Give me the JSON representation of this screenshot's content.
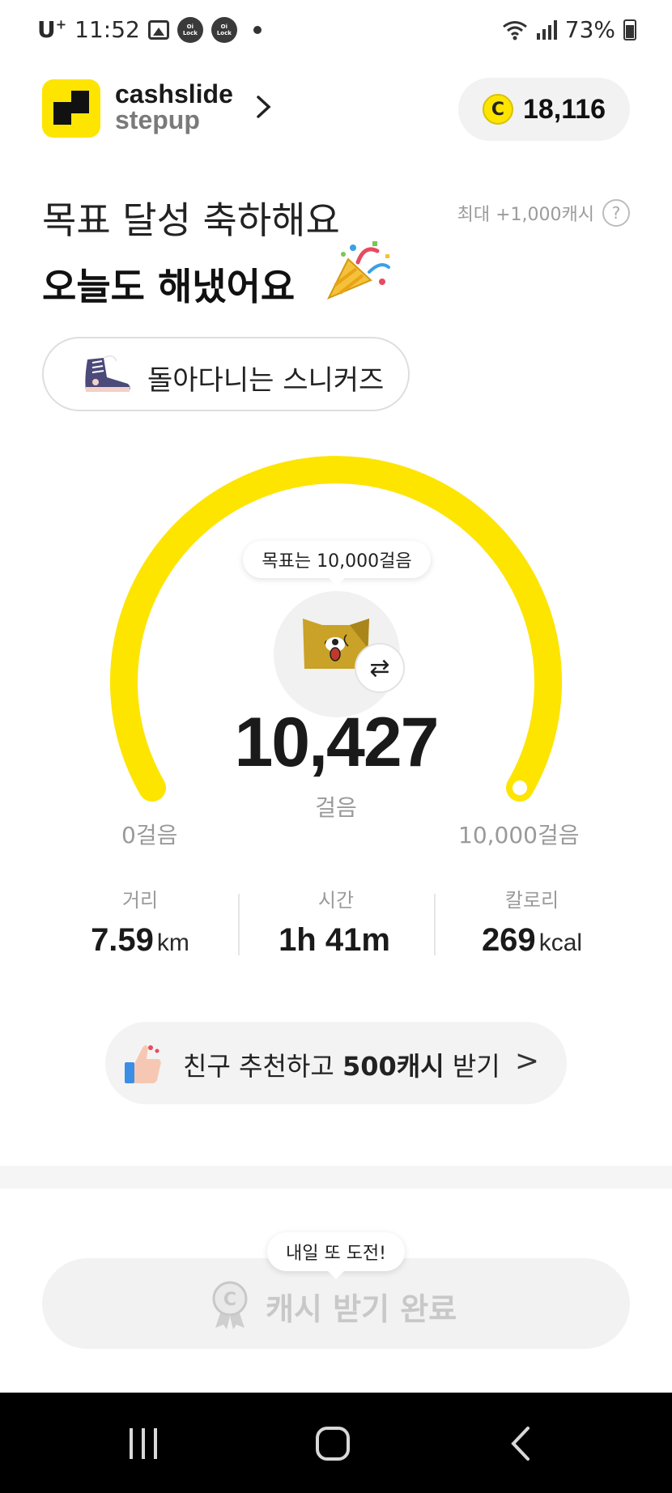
{
  "status_bar": {
    "carrier": "U",
    "carrier_sup": "+",
    "time": "11:52",
    "lock_badge": "Oi\nLock",
    "battery": "73%"
  },
  "header": {
    "brand_line1": "cashslide",
    "brand_line2": "stepup",
    "cash_coin_symbol": "C",
    "cash_amount": "18,116"
  },
  "hero": {
    "title_line1": "목표 달성 축하해요",
    "title_line2": "오늘도 해냈어요",
    "max_reward": "최대 +1,000캐시",
    "help_symbol": "?"
  },
  "badge": {
    "label": "돌아다니는 스니커즈"
  },
  "gauge": {
    "goal_bubble": "목표는 10,000걸음",
    "steps": "10,427",
    "steps_value": 10427,
    "goal_value": 10000,
    "progress_fraction": 1.0,
    "unit": "걸음",
    "min_label": "0걸음",
    "max_label": "10,000걸음",
    "swap_symbol": "⇄",
    "accent_color": "#fde500"
  },
  "stats": [
    {
      "label": "거리",
      "value": "7.59",
      "unit": "km"
    },
    {
      "label": "시간",
      "value": "1h 41m",
      "unit": ""
    },
    {
      "label": "칼로리",
      "value": "269",
      "unit": "kcal"
    }
  ],
  "referral": {
    "text_before": "친구 추천하고 ",
    "text_bold": "500캐시",
    "text_after": " 받기",
    "chevron": ">"
  },
  "claim": {
    "bubble": "내일 또 도전!",
    "label": "캐시 받기 완료"
  },
  "icons": {
    "brand_chevron": "chevron-right-icon",
    "party": "party-popper-icon",
    "sneaker": "sneaker-icon",
    "character": "dog-character-icon",
    "thumbs": "thumbs-up-icon",
    "claim": "cash-medal-icon"
  }
}
